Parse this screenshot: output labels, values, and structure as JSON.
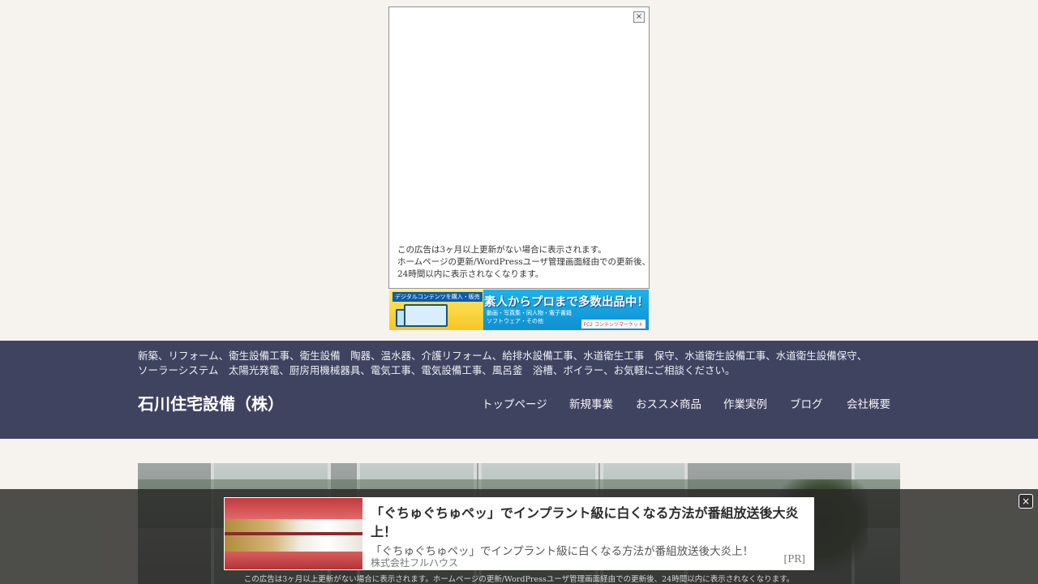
{
  "top_ad": {
    "close_label": "×",
    "notice_lines": [
      "この広告は3ヶ月以上更新がない場合に表示されます。",
      "ホームページの更新/WordPressユーザ管理画面経由での更新後、",
      "24時間以内に表示されなくなります。"
    ]
  },
  "banner": {
    "tag": "デジタルコンテンツを購入・販売",
    "title": "素人からプロまで多数出品中！",
    "sub_line1": "動画・写真集・同人物・電子書籍",
    "sub_line2": "ソフトウェア・その他",
    "brand": "FC2 コンテンツマーケット"
  },
  "header": {
    "tagline_lines": [
      "新築、リフォーム、衛生設備工事、衛生設備　陶器、温水器、介護リフォーム、給排水設備工事、水道衛生工事　保守、水道衛生設備工事、水道衛生設備保守、",
      "ソーラーシステム　太陽光発電、厨房用機械器具、電気工事、電気設備工事、風呂釜　浴槽、ボイラー、お気軽にご相談ください。"
    ],
    "site_title": "石川住宅設備（株）",
    "nav": [
      {
        "label": "トップページ"
      },
      {
        "label": "新規事業"
      },
      {
        "label": "おススメ商品"
      },
      {
        "label": "作業実例"
      },
      {
        "label": "ブログ"
      },
      {
        "label": "会社概要"
      }
    ]
  },
  "bottom_ad": {
    "close_label": "×",
    "title": "「ぐちゅぐちゅペッ」でインプラント級に白くなる方法が番組放送後大炎上！",
    "description": "「ぐちゅぐちゅペッ」でインプラント級に白くなる方法が番組放送後大炎上！",
    "company": "株式会社フルハウス",
    "pr_label": "[PR]",
    "notice": "この広告は3ヶ月以上更新がない場合に表示されます。ホームページの更新/WordPressユーザ管理画面経由での更新後、24時間以内に表示されなくなります。"
  },
  "colors": {
    "page_bg": "#f6f3ef",
    "header_bg": "#404360",
    "overlay_bg": "#2a2a28"
  }
}
